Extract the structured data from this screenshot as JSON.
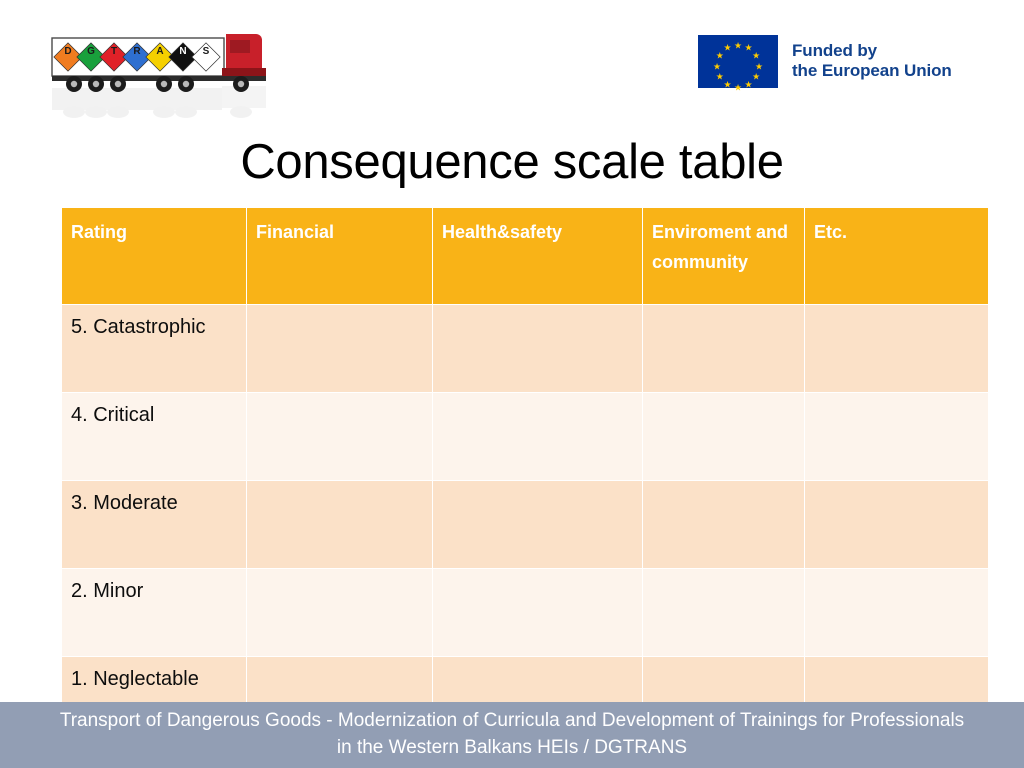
{
  "slide": {
    "title": "Consequence scale table",
    "background_color": "#FFFFFF"
  },
  "branding": {
    "project_logo": {
      "icon": "dgtrans-truck-logo",
      "alt": "DGTRANS truck with hazard placards",
      "placards": [
        "D",
        "G",
        "T",
        "R",
        "A",
        "N",
        "S"
      ],
      "placard_colors": [
        "#F07C20",
        "#19A03C",
        "#E02128",
        "#2E6FD0",
        "#F5D000",
        "#101010",
        "#FFFFFF"
      ]
    },
    "eu_logo": {
      "icon": "eu-flag-icon",
      "line1": "Funded by",
      "line2": "the European Union",
      "flag_color": "#003399",
      "star_color": "#FFCC00",
      "text_color": "#12428C"
    }
  },
  "table": {
    "header_bg": "#F9B317",
    "header_text_color": "#FFFFFF",
    "row_bg_odd": "#FBE1C8",
    "row_bg_even": "#FDF4EC",
    "columns": [
      "Rating",
      "Financial",
      "Health&safety",
      "Enviroment and community",
      "Etc."
    ],
    "rows": [
      {
        "rating": "5. Catastrophic",
        "financial": "",
        "health_safety": "",
        "environment": "",
        "etc": ""
      },
      {
        "rating": "4. Critical",
        "financial": "",
        "health_safety": "",
        "environment": "",
        "etc": ""
      },
      {
        "rating": "3. Moderate",
        "financial": "",
        "health_safety": "",
        "environment": "",
        "etc": ""
      },
      {
        "rating": "2. Minor",
        "financial": "",
        "health_safety": "",
        "environment": "",
        "etc": ""
      },
      {
        "rating": "1. Neglectable",
        "financial": "",
        "health_safety": "",
        "environment": "",
        "etc": ""
      }
    ]
  },
  "footer": {
    "line1": "Transport of Dangerous Goods - Modernization of Curricula and Development of Trainings for Professionals",
    "line2": "in the Western Balkans HEIs / DGTRANS",
    "background_color": "#929EB4",
    "text_color": "#FFFFFF"
  }
}
